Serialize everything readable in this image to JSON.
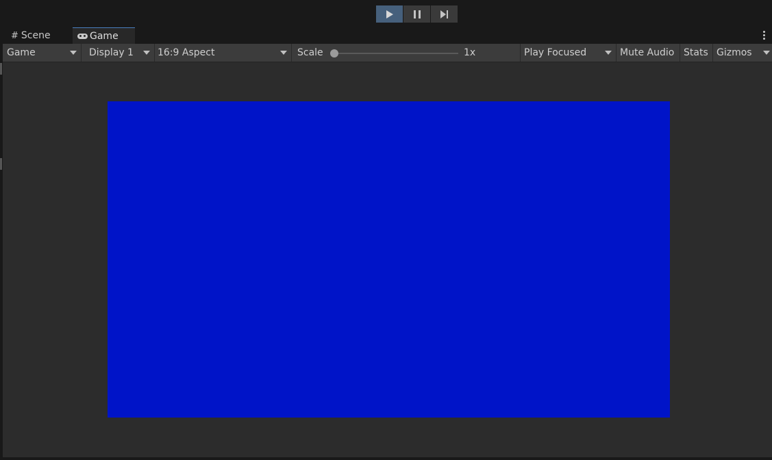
{
  "play_controls": {
    "play_icon": "play-icon",
    "pause_icon": "pause-icon",
    "step_icon": "step-forward-icon"
  },
  "tabs": [
    {
      "label": "Scene",
      "icon": "grid-icon",
      "active": false
    },
    {
      "label": "Game",
      "icon": "gamepad-icon",
      "active": true
    }
  ],
  "toolbar": {
    "game_dropdown": "Game",
    "display_dropdown": "Display 1",
    "aspect_dropdown": "16:9 Aspect",
    "scale_label": "Scale",
    "scale_value": "1x",
    "scale_level": 0,
    "play_mode_dropdown": "Play Focused",
    "mute_audio": "Mute Audio",
    "stats": "Stats",
    "gizmos": "Gizmos"
  },
  "game_view": {
    "background_color": "#0014c8"
  },
  "colors": {
    "accent": "#4a7fc1",
    "active_play": "#46607c"
  }
}
